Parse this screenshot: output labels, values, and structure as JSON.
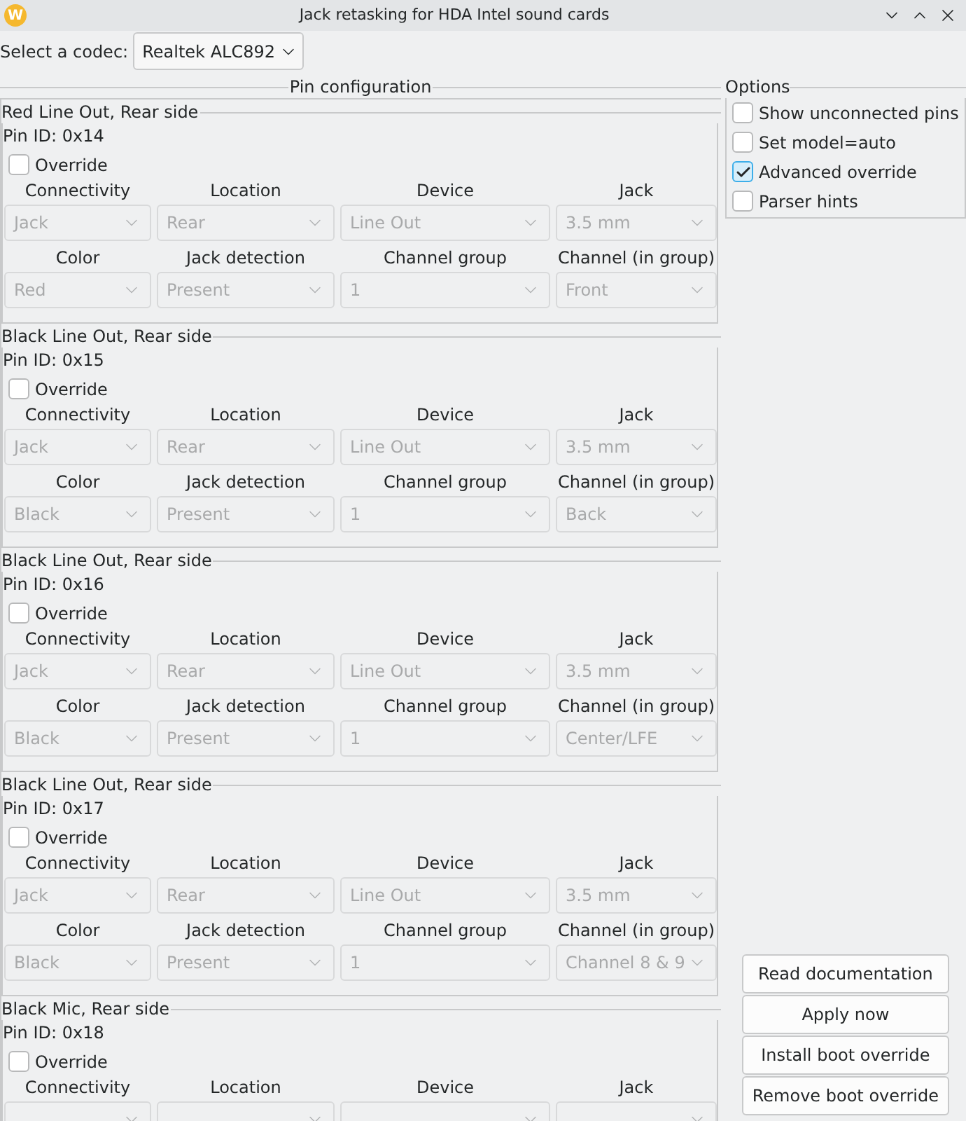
{
  "window": {
    "title": "Jack retasking for HDA Intel sound cards",
    "logo": "W"
  },
  "codec": {
    "label": "Select a codec:",
    "value": "Realtek ALC892"
  },
  "pin_configuration": {
    "title": "Pin configuration",
    "pins": [
      {
        "title": "Red Line Out, Rear side",
        "pin_id": "Pin ID: 0x14",
        "override": {
          "label": "Override",
          "checked": false
        },
        "fields": [
          {
            "label": "Connectivity",
            "value": "Jack"
          },
          {
            "label": "Location",
            "value": "Rear"
          },
          {
            "label": "Device",
            "value": "Line Out"
          },
          {
            "label": "Jack",
            "value": "3.5 mm"
          },
          {
            "label": "Color",
            "value": "Red"
          },
          {
            "label": "Jack detection",
            "value": "Present"
          },
          {
            "label": "Channel group",
            "value": "1"
          },
          {
            "label": "Channel (in group)",
            "value": "Front"
          }
        ]
      },
      {
        "title": "Black Line Out, Rear side",
        "pin_id": "Pin ID: 0x15",
        "override": {
          "label": "Override",
          "checked": false
        },
        "fields": [
          {
            "label": "Connectivity",
            "value": "Jack"
          },
          {
            "label": "Location",
            "value": "Rear"
          },
          {
            "label": "Device",
            "value": "Line Out"
          },
          {
            "label": "Jack",
            "value": "3.5 mm"
          },
          {
            "label": "Color",
            "value": "Black"
          },
          {
            "label": "Jack detection",
            "value": "Present"
          },
          {
            "label": "Channel group",
            "value": "1"
          },
          {
            "label": "Channel (in group)",
            "value": "Back"
          }
        ]
      },
      {
        "title": "Black Line Out, Rear side",
        "pin_id": "Pin ID: 0x16",
        "override": {
          "label": "Override",
          "checked": false
        },
        "fields": [
          {
            "label": "Connectivity",
            "value": "Jack"
          },
          {
            "label": "Location",
            "value": "Rear"
          },
          {
            "label": "Device",
            "value": "Line Out"
          },
          {
            "label": "Jack",
            "value": "3.5 mm"
          },
          {
            "label": "Color",
            "value": "Black"
          },
          {
            "label": "Jack detection",
            "value": "Present"
          },
          {
            "label": "Channel group",
            "value": "1"
          },
          {
            "label": "Channel (in group)",
            "value": "Center/LFE"
          }
        ]
      },
      {
        "title": "Black Line Out, Rear side",
        "pin_id": "Pin ID: 0x17",
        "override": {
          "label": "Override",
          "checked": false
        },
        "fields": [
          {
            "label": "Connectivity",
            "value": "Jack"
          },
          {
            "label": "Location",
            "value": "Rear"
          },
          {
            "label": "Device",
            "value": "Line Out"
          },
          {
            "label": "Jack",
            "value": "3.5 mm"
          },
          {
            "label": "Color",
            "value": "Black"
          },
          {
            "label": "Jack detection",
            "value": "Present"
          },
          {
            "label": "Channel group",
            "value": "1"
          },
          {
            "label": "Channel (in group)",
            "value": "Channel 8 & 9"
          }
        ]
      },
      {
        "title": "Black Mic, Rear side",
        "pin_id": "Pin ID: 0x18",
        "override": {
          "label": "Override",
          "checked": false
        },
        "fields": [
          {
            "label": "Connectivity"
          },
          {
            "label": "Location"
          },
          {
            "label": "Device"
          },
          {
            "label": "Jack"
          }
        ]
      }
    ]
  },
  "options": {
    "title": "Options",
    "items": [
      {
        "label": "Show unconnected pins",
        "checked": false
      },
      {
        "label": "Set model=auto",
        "checked": false
      },
      {
        "label": "Advanced override",
        "checked": true
      },
      {
        "label": "Parser hints",
        "checked": false
      }
    ]
  },
  "buttons": [
    "Read documentation",
    "Apply now",
    "Install boot override",
    "Remove boot override"
  ]
}
